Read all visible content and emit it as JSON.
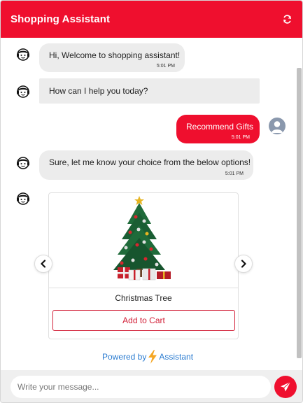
{
  "header": {
    "title": "Shopping Assistant",
    "refresh_icon": "refresh-icon"
  },
  "messages": [
    {
      "sender": "bot",
      "text": "Hi, Welcome to shopping assistant!",
      "time": "5:01 PM"
    },
    {
      "sender": "bot",
      "text": "How can I help you today?"
    },
    {
      "sender": "user",
      "text": "Recommend Gifts",
      "time": "5:01 PM"
    },
    {
      "sender": "bot",
      "text": "Sure, let me know your choice from the below options!",
      "time": "5:01 PM"
    }
  ],
  "carousel": {
    "product": {
      "name": "Christmas Tree",
      "action_label": "Add to Cart",
      "image_icon": "christmas-tree-image"
    },
    "prev_icon": "chevron-left-icon",
    "next_icon": "chevron-right-icon"
  },
  "powered_by": {
    "label": "Powered by",
    "brand": "Assistant",
    "icon": "lightning-bolt-icon"
  },
  "composer": {
    "placeholder": "Write your message...",
    "send_icon": "send-icon"
  },
  "colors": {
    "brand": "#ef0f2e",
    "bubble": "#ececec",
    "link": "#2a7bd0",
    "bolt": "#f5a623"
  }
}
